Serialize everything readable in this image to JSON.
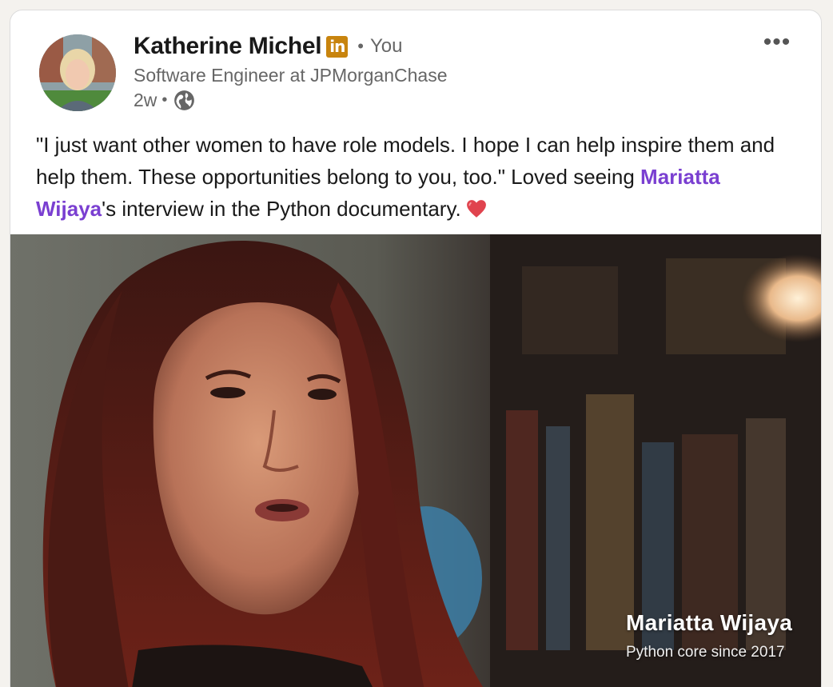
{
  "post": {
    "author": {
      "name": "Katherine Michel",
      "badge_text": "in",
      "separator": "•",
      "relation": "You",
      "headline": "Software Engineer at JPMorganChase",
      "age": "2w",
      "meta_separator": "•",
      "visibility_icon": "globe-icon"
    },
    "menu_label": "•••",
    "text": {
      "before_mention": "\"I just want other women to have role models. I hope I can help inspire them and help them. These opportunities belong to you, too.\" Loved seeing ",
      "mention": "Mariatta Wijaya",
      "after_mention": "'s interview in the Python documentary.",
      "emoji_icon": "red-heart-icon"
    },
    "media": {
      "caption_name": "Mariatta Wijaya",
      "caption_subtitle": "Python core since 2017"
    }
  },
  "colors": {
    "mention": "#7a3fd1",
    "badge": "#c8840e",
    "secondary_text": "#666666"
  }
}
